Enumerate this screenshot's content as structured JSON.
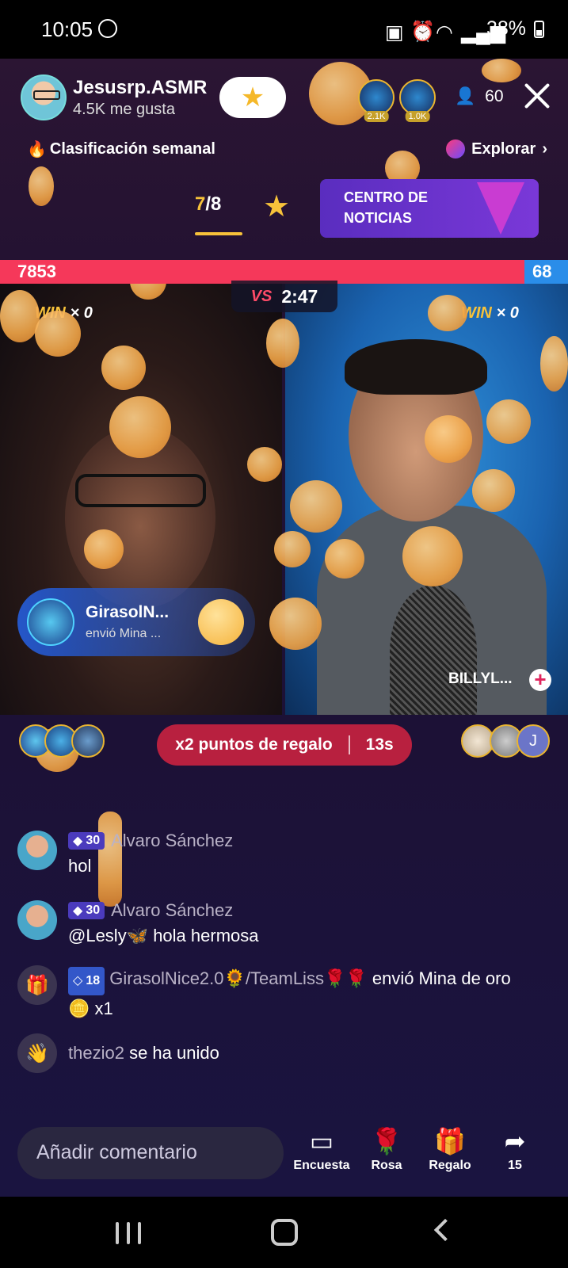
{
  "status": {
    "time": "10:05",
    "battery": "38%"
  },
  "header": {
    "host_name": "Jesusrp.ASMR",
    "host_likes": "4.5K me gusta",
    "top_viewers": [
      {
        "count": "2.1K"
      },
      {
        "count": "1.0K"
      }
    ],
    "viewer_count": "60"
  },
  "ranking": {
    "weekly_label": "Clasificación semanal",
    "explore_label": "Explorar",
    "progress_current": "7",
    "progress_total": "/8",
    "news_line1": "CENTRO DE",
    "news_line2": "NOTICIAS"
  },
  "battle": {
    "score_left": "7853",
    "score_right": "68",
    "vs_label": "VS",
    "timer": "2:47",
    "win_left_label": "WIN",
    "win_left_count": "× 0",
    "win_right_label": "WIN",
    "win_right_count": "× 0",
    "opponent_name": "BILLYL...",
    "plus_label": "+"
  },
  "gift_notice": {
    "name": "GirasolN...",
    "text": "envió Mina ..."
  },
  "bonus": {
    "label": "x2 puntos de regalo",
    "countdown": "13s"
  },
  "right_viewers": {
    "third_initial": "J"
  },
  "chat": [
    {
      "level": "30",
      "user": "Alvaro Sánchez",
      "message": "hol"
    },
    {
      "level": "30",
      "user": "Alvaro Sánchez",
      "message": "@Lesly🦋 hola hermosa"
    }
  ],
  "system_messages": {
    "gift": {
      "level": "18",
      "user": "GirasolNice2.0🌻/TeamLiss🌹🌹",
      "text": " envió Mina de oro 🪙 x1"
    },
    "join": {
      "user": "thezio2",
      "text": " se ha unido"
    }
  },
  "bottom": {
    "comment_placeholder": "Añadir comentario",
    "actions": [
      {
        "label": "Encuesta",
        "icon": "poll-icon"
      },
      {
        "label": "Rosa",
        "icon": "rose-icon"
      },
      {
        "label": "Regalo",
        "icon": "gift-icon"
      },
      {
        "label": "15",
        "icon": "share-icon"
      }
    ]
  },
  "colors": {
    "score_left": "#f5385a",
    "score_right": "#2a8de9",
    "bonus_pill": "#b8203f",
    "accent_gold": "#f7c23a"
  }
}
